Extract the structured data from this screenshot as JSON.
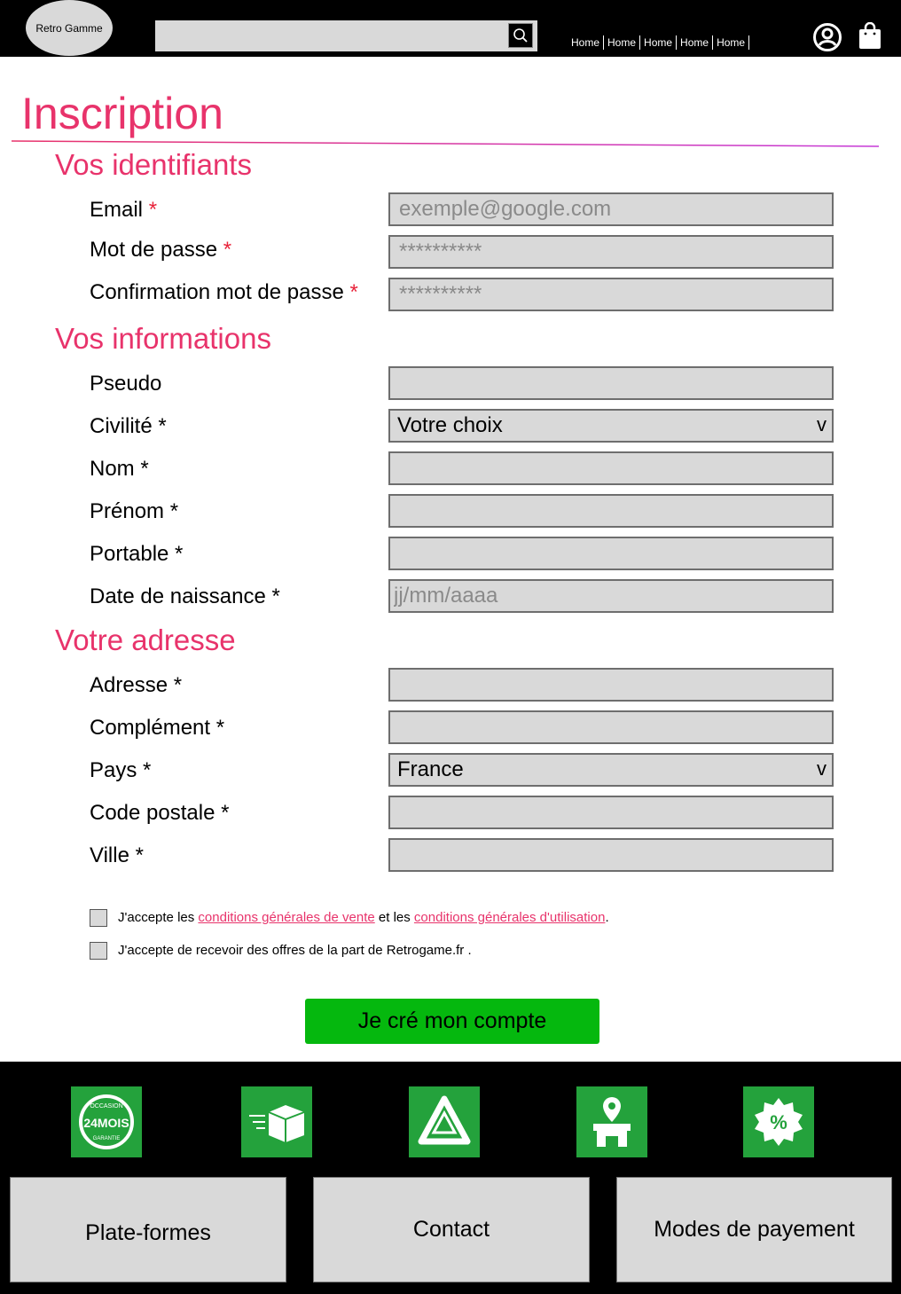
{
  "header": {
    "logo": "Retro Gamme",
    "search_placeholder": "",
    "nav": [
      "Home",
      "Home",
      "Home",
      "Home",
      "Home"
    ]
  },
  "page": {
    "title": "Inscription",
    "sections": {
      "identifiants": "Vos identifiants",
      "informations": "Vos informations",
      "adresse": "Votre adresse"
    }
  },
  "form": {
    "email": {
      "label": "Email ",
      "required": "*",
      "placeholder": "exemple@google.com"
    },
    "password": {
      "label": "Mot de passe ",
      "required": "*",
      "placeholder": "**********"
    },
    "password_confirm": {
      "label": "Confirmation mot de passe ",
      "required": "*",
      "placeholder": "**********"
    },
    "pseudo": {
      "label": "Pseudo"
    },
    "civilite": {
      "label": "Civilité *",
      "value": "Votre choix",
      "chevron": "v"
    },
    "nom": {
      "label": "Nom *"
    },
    "prenom": {
      "label": "Prénom *"
    },
    "portable": {
      "label": "Portable *"
    },
    "naissance": {
      "label": "Date de naissance *",
      "placeholder": "jj/mm/aaaa"
    },
    "adresse": {
      "label": "Adresse *"
    },
    "complement": {
      "label": "Complément *"
    },
    "pays": {
      "label": "Pays *",
      "value": "France",
      "chevron": "v"
    },
    "code_postal": {
      "label": "Code postale *"
    },
    "ville": {
      "label": "Ville *"
    }
  },
  "consent": {
    "cgv_prefix": "J'accepte les ",
    "cgv_link": "conditions générales de vente",
    "cgv_middle": " et les ",
    "cgu_link": "conditions générales d'utilisation",
    "cgv_suffix": ".",
    "offers": "J'accepte de recevoir des offres de la part de Retrogame.fr ."
  },
  "submit_label": "Je cré mon compte",
  "footer": {
    "badges": [
      {
        "icon": "warranty-24-months-icon",
        "line1": "OCCASION",
        "line2": "24MOIS",
        "line3": "GARANTIE"
      },
      {
        "icon": "fast-delivery-icon"
      },
      {
        "icon": "recycle-icon"
      },
      {
        "icon": "store-location-icon"
      },
      {
        "icon": "discount-badge-icon",
        "text": "%"
      }
    ],
    "boxes": [
      "Plate-formes",
      "Contact",
      "Modes de payement"
    ]
  },
  "colors": {
    "accent": "#e8336b",
    "required": "#e8233a",
    "submit": "#05b80e",
    "badge": "#24a23c",
    "field_bg": "#d9d9d9"
  }
}
